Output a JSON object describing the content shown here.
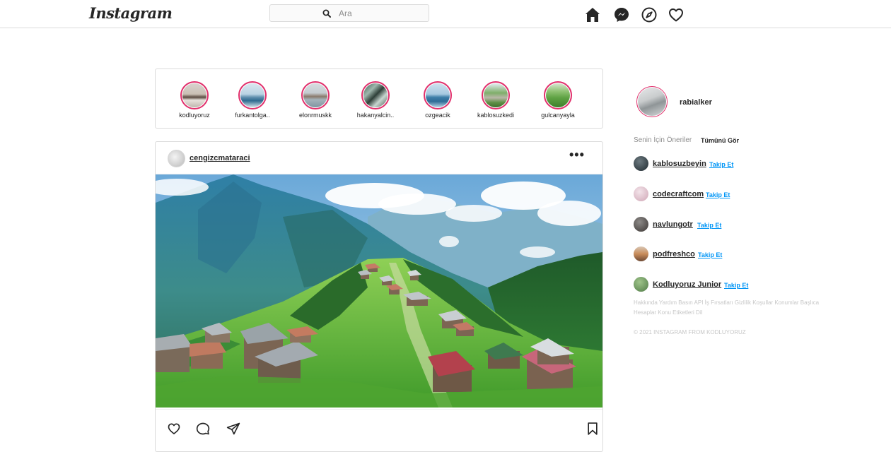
{
  "header": {
    "logo": "Instagram",
    "search_placeholder": "Ara",
    "icons": [
      "home-icon",
      "messenger-icon",
      "explore-icon",
      "heart-icon"
    ]
  },
  "stories": [
    {
      "username": "kodluyoruz"
    },
    {
      "username": "furkantolga.."
    },
    {
      "username": "elonrmuskk"
    },
    {
      "username": "hakanyalcin.."
    },
    {
      "username": "ozgeacik"
    },
    {
      "username": "kablosuzkedi"
    },
    {
      "username": "gulcanyayla"
    }
  ],
  "post": {
    "username": "cengizcmataraci",
    "more": "•••",
    "actions": [
      "like-icon",
      "comment-icon",
      "share-icon",
      "save-icon"
    ]
  },
  "profile": {
    "username": "rabialker"
  },
  "suggestions": {
    "title": "Senin İçin Öneriler",
    "see_all": "Tümünü Gör",
    "follow_label": "Takip Et",
    "users": [
      {
        "username": "kablosuzbeyin"
      },
      {
        "username": "codecraftcom"
      },
      {
        "username": "navlungotr"
      },
      {
        "username": "podfreshco"
      },
      {
        "username": "Kodluyoruz Junior"
      }
    ]
  },
  "footer": {
    "links": "Hakkında Yardım Basın API İş Fırsatları Gizlilik Koşullar Konumlar Başlıca Hesaplar Konu Etiketleri Dil",
    "copyright": "© 2021 INSTAGRAM FROM KODLUYORUZ"
  },
  "colors": {
    "story_ring": "#e1306c",
    "follow_link": "#0095f6",
    "border": "#dbdbdb"
  }
}
